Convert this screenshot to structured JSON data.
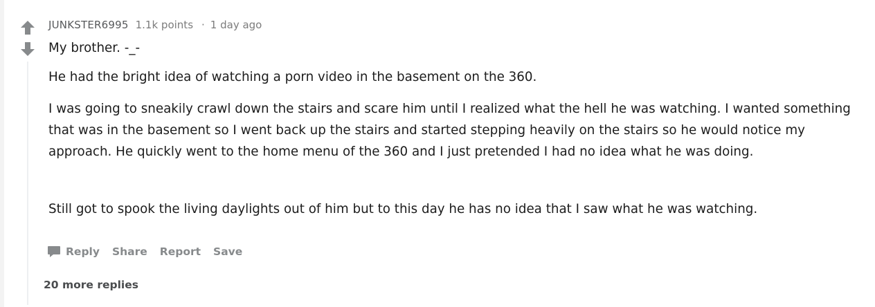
{
  "vote": {
    "upvote_icon": "arrow-up-icon",
    "downvote_icon": "arrow-down-icon"
  },
  "comment": {
    "author": "JUNKSTER6995",
    "points": "1.1k points",
    "separator": "·",
    "time": "1 day ago",
    "paragraphs": [
      "My brother. -_-",
      "He had the bright idea of watching a porn video in the basement on the 360.",
      "I was going to sneakily crawl down the stairs and scare him until I realized what the hell he was watching. I wanted something that was in the basement so I went back up the stairs and started stepping heavily on the stairs so he would notice my approach. He quickly went to the home menu of the 360 and I just pretended I had no idea what he was doing.",
      "Still got to spook the living daylights out of him but to this day he has no idea that I saw what he was watching."
    ]
  },
  "actions": {
    "reply_icon": "speech-bubble-icon",
    "reply": "Reply",
    "share": "Share",
    "report": "Report",
    "save": "Save"
  },
  "more_replies": "20 more replies",
  "colors": {
    "arrow": "#878a8c",
    "meta_text": "#7c7c7c",
    "body_text": "#1c1c1c",
    "thread_line": "#edeff1",
    "action_text": "#878a8c"
  }
}
